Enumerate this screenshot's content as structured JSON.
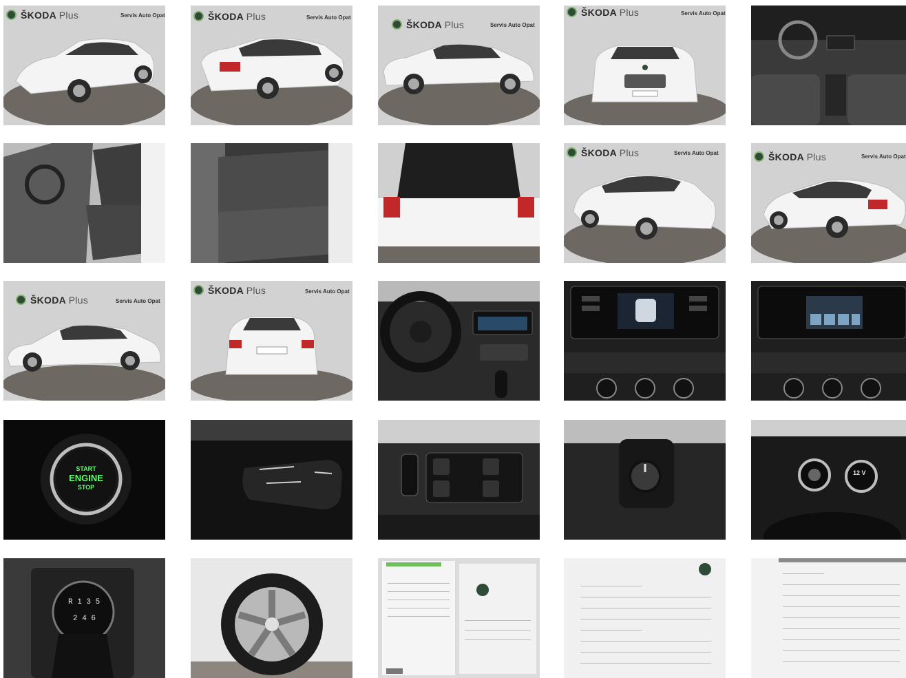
{
  "gallery": {
    "brand": "ŠKODA",
    "brand_suffix": "Plus",
    "dealer": "Servis Auto Opat",
    "start_button": {
      "line1": "START",
      "line2": "ENGINE",
      "line3": "STOP"
    },
    "gear_pattern": {
      "top": "R 1 3 5",
      "bottom": "2 4 6"
    },
    "socket_label": "12 V",
    "colors": {
      "car_white": "#f4f4f4",
      "showroom_wall": "#cfcfcf",
      "turntable": "#6d6862",
      "interior_dark": "#2c2c2c",
      "engine_green": "#5cff6a"
    }
  }
}
